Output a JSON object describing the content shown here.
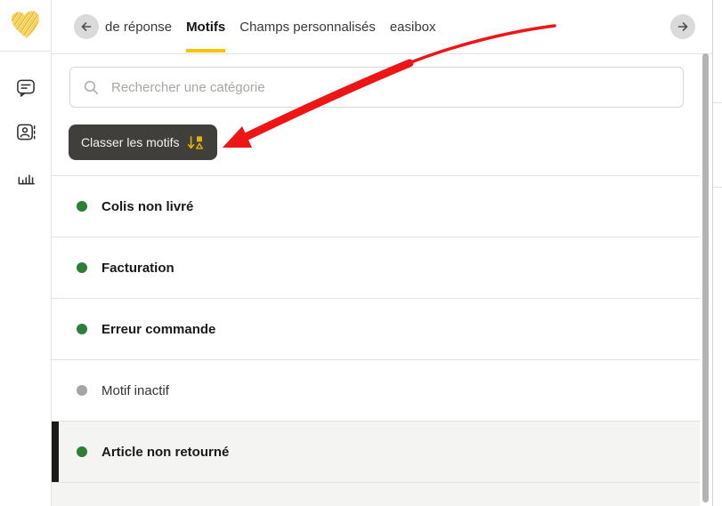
{
  "header": {
    "tabs": [
      {
        "label": "de réponse",
        "active": false
      },
      {
        "label": "Motifs",
        "active": true
      },
      {
        "label": "Champs personnalisés",
        "active": false
      },
      {
        "label": "easibox",
        "active": false
      }
    ],
    "back_icon": "arrow-left",
    "forward_icon": "arrow-right"
  },
  "sidebar": {
    "logo_icon": "scribble-heart",
    "items": [
      {
        "icon": "chat-bubble-icon"
      },
      {
        "icon": "contact-card-icon"
      },
      {
        "icon": "bar-chart-icon"
      }
    ]
  },
  "search": {
    "placeholder": "Rechercher une catégorie",
    "value": "",
    "icon": "magnifier-icon"
  },
  "toolbar": {
    "sort_button_label": "Classer les motifs",
    "sort_button_icon": "sort-shapes-descending-icon"
  },
  "categories": [
    {
      "name": "Colis non livré",
      "status": "active",
      "selected": false
    },
    {
      "name": "Facturation",
      "status": "active",
      "selected": false
    },
    {
      "name": "Erreur commande",
      "status": "active",
      "selected": false
    },
    {
      "name": "Motif inactif",
      "status": "inactive",
      "selected": false
    },
    {
      "name": "Article non retourné",
      "status": "active",
      "selected": true
    }
  ],
  "annotation": {
    "type": "red-arrow",
    "points_to": "sort-button"
  },
  "colors": {
    "accent_yellow": "#f6c400",
    "logo_yellow": "#f4c426",
    "button_bg": "#403f3b",
    "button_icon_yellow": "#e6b10a",
    "status_active_green": "#2e7e36",
    "status_inactive_gray": "#a5a5a5",
    "selected_row_bg": "#f4f4f2",
    "selected_bar": "#1b1b19",
    "annotation_arrow_red": "#ed1515"
  }
}
